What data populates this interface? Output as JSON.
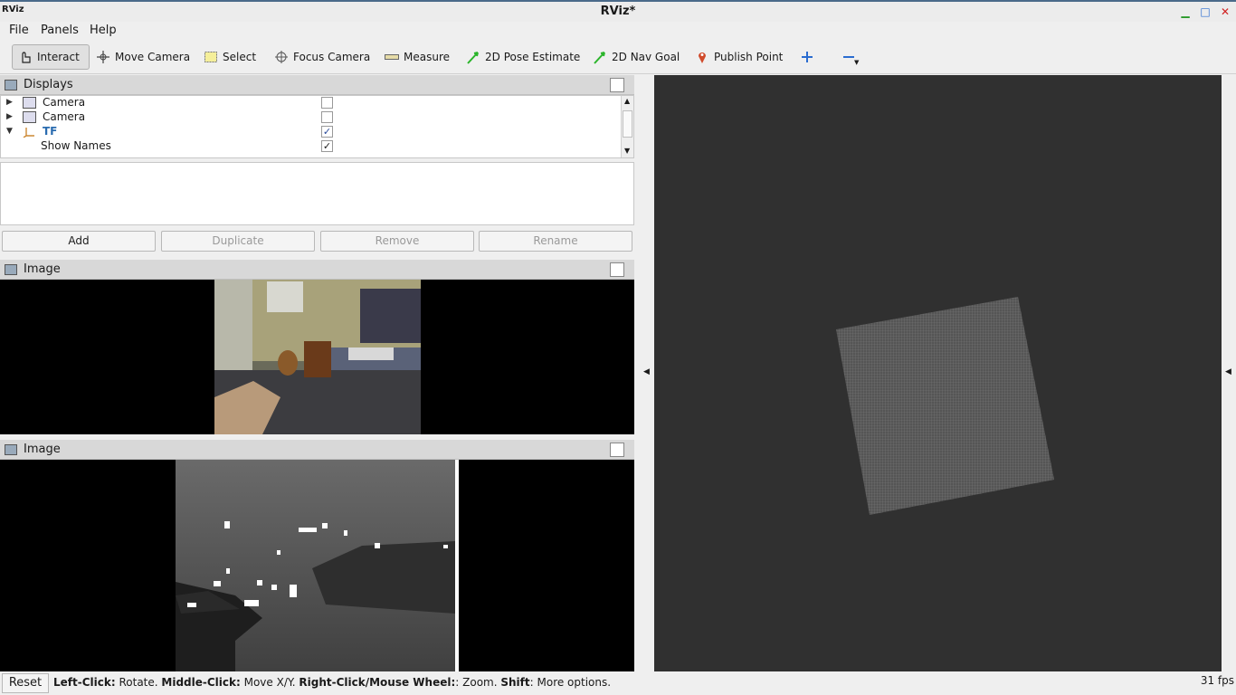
{
  "window": {
    "title": "RViz*",
    "logo": "RViz"
  },
  "menu": [
    "File",
    "Panels",
    "Help"
  ],
  "toolbar": {
    "tools": [
      {
        "label": "Interact",
        "icon": "hand-icon"
      },
      {
        "label": "Move Camera",
        "icon": "move-camera-icon"
      },
      {
        "label": "Select",
        "icon": "select-icon"
      },
      {
        "label": "Focus Camera",
        "icon": "focus-camera-icon"
      },
      {
        "label": "Measure",
        "icon": "ruler-icon"
      },
      {
        "label": "2D Pose Estimate",
        "icon": "pose-arrow-icon"
      },
      {
        "label": "2D Nav Goal",
        "icon": "nav-goal-arrow-icon"
      },
      {
        "label": "Publish Point",
        "icon": "map-pin-icon"
      }
    ]
  },
  "displays": {
    "title": "Displays",
    "items": [
      {
        "label": "Camera",
        "checked": ""
      },
      {
        "label": "Camera",
        "checked": ""
      },
      {
        "label": "TF",
        "checked": "✓"
      },
      {
        "label": "Show Names",
        "checked": "✓"
      }
    ],
    "buttons": [
      "Add",
      "Duplicate",
      "Remove",
      "Rename"
    ]
  },
  "image_panels": [
    {
      "title": "Image"
    },
    {
      "title": "Image"
    }
  ],
  "status": {
    "reset_label": "Reset",
    "left_click": "Left-Click:",
    "left_click_desc": " Rotate. ",
    "middle_click": "Middle-Click:",
    "middle_click_desc": " Move X/Y. ",
    "right_click": "Right-Click/Mouse Wheel:",
    "right_click_desc": ": Zoom. ",
    "shift": "Shift",
    "shift_desc": ": More options.",
    "fps": "31 fps"
  },
  "colors": {
    "viewport_bg": "#303030",
    "grid": "#7a7a7a",
    "accent": "#2a6cb0"
  }
}
